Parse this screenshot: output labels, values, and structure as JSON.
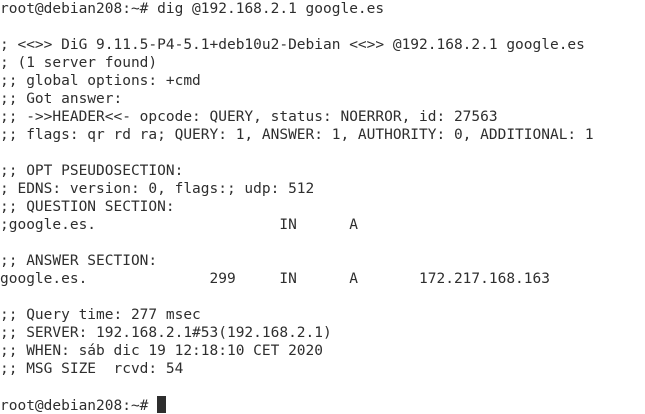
{
  "terminal": {
    "prompt": "root@debian208:~#",
    "command": "dig @192.168.2.1 google.es",
    "banner": "; <<>> DiG 9.11.5-P4-5.1+deb10u2-Debian <<>> @192.168.2.1 google.es",
    "servers_found": "; (1 server found)",
    "global_options": ";; global options: +cmd",
    "got_answer": ";; Got answer:",
    "header": ";; ->>HEADER<<- opcode: QUERY, status: NOERROR, id: 27563",
    "flags": ";; flags: qr rd ra; QUERY: 1, ANSWER: 1, AUTHORITY: 0, ADDITIONAL: 1",
    "opt_section": ";; OPT PSEUDOSECTION:",
    "edns": "; EDNS: version: 0, flags:; udp: 512",
    "question_section": ";; QUESTION SECTION:",
    "question_record": ";google.es.                     IN      A",
    "answer_section": ";; ANSWER SECTION:",
    "answer_record": "google.es.              299     IN      A       172.217.168.163",
    "query_time": ";; Query time: 277 msec",
    "server": ";; SERVER: 192.168.2.1#53(192.168.2.1)",
    "when": ";; WHEN: sáb dic 19 12:18:10 CET 2020",
    "msg_size": ";; MSG SIZE  rcvd: 54",
    "final_prompt": "root@debian208:~#"
  }
}
